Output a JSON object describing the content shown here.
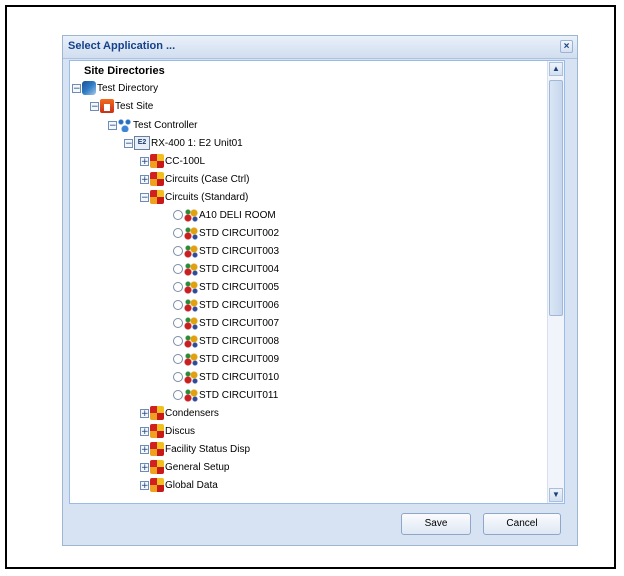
{
  "dialog": {
    "title": "Select Application ...",
    "close_label": "×",
    "save_label": "Save",
    "cancel_label": "Cancel"
  },
  "tree": {
    "heading": "Site Directories",
    "directory": "Test Directory",
    "site": "Test Site",
    "controller": "Test Controller",
    "unit": "RX-400 1: E2 Unit01",
    "e2_badge": "E2",
    "apps": [
      "CC-100L",
      "Circuits (Case Ctrl)",
      "Circuits (Standard)",
      "Condensers",
      "Discus",
      "Facility Status Disp",
      "General Setup",
      "Global Data"
    ],
    "circuits": [
      "A10 DELI ROOM",
      "STD CIRCUIT002",
      "STD CIRCUIT003",
      "STD CIRCUIT004",
      "STD CIRCUIT005",
      "STD CIRCUIT006",
      "STD CIRCUIT007",
      "STD CIRCUIT008",
      "STD CIRCUIT009",
      "STD CIRCUIT010",
      "STD CIRCUIT011"
    ],
    "expander_collapse": "−",
    "expander_expand": "+"
  },
  "scrollbar": {
    "up": "▲",
    "down": "▼"
  }
}
